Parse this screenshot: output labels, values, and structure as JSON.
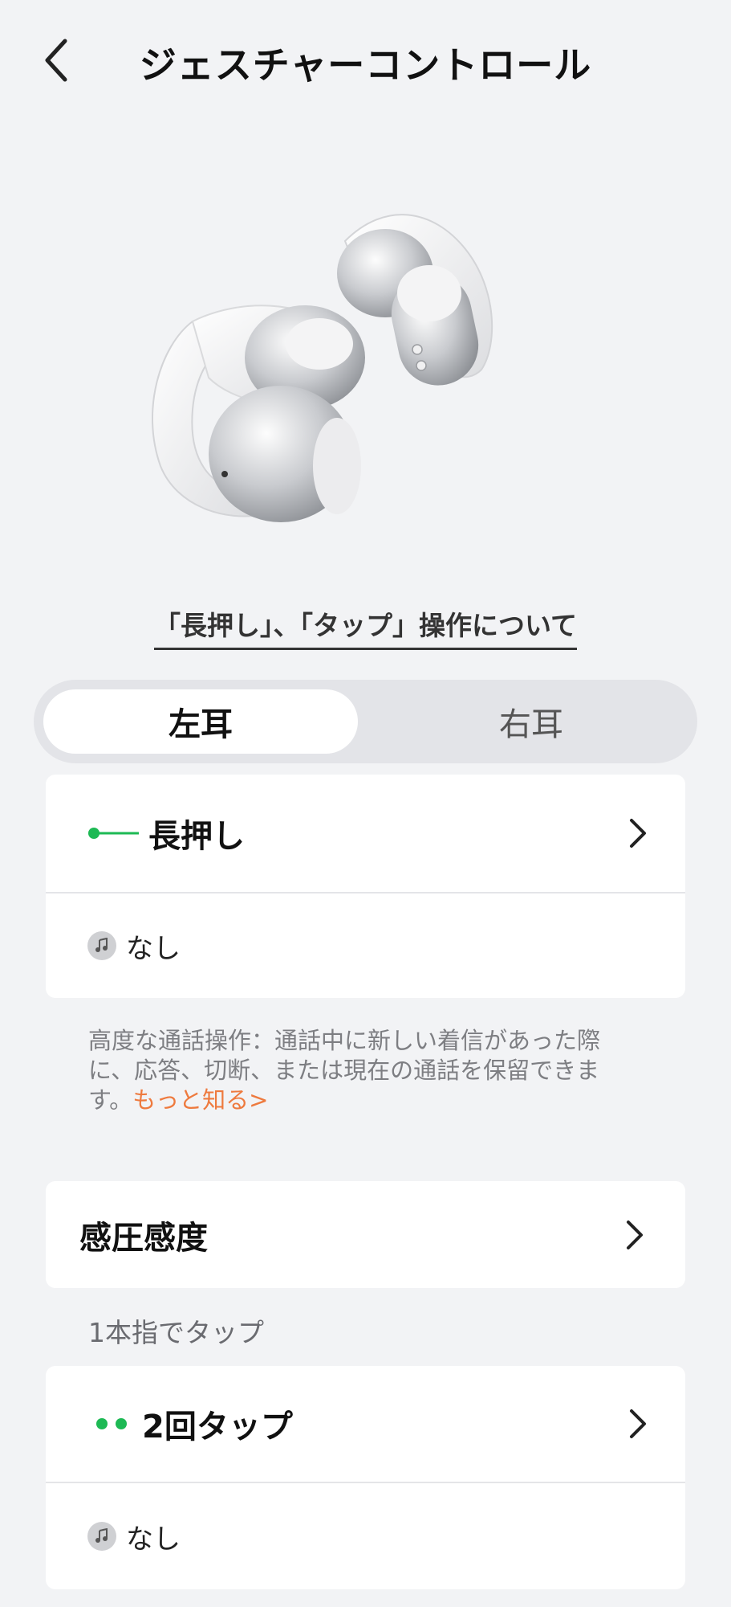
{
  "header": {
    "title": "ジェスチャーコントロール"
  },
  "gesture_info_link": "「長押し」、「タップ」操作について",
  "ear_tabs": {
    "left": "左耳",
    "right": "右耳",
    "selected": "左耳"
  },
  "long_press": {
    "title": "長押し",
    "action": "なし"
  },
  "call_note": {
    "text": "高度な通話操作：通話中に新しい着信があった際に、応答、切断、または現在の通話を保留できます。",
    "link": "もっと知る>"
  },
  "pressure_sensitivity": {
    "title": "感圧感度"
  },
  "one_finger_section": {
    "label": "1本指でタップ",
    "double_tap": {
      "title": "2回タップ",
      "action": "なし"
    }
  },
  "colors": {
    "accent_green": "#1db954",
    "link_orange": "#ee7a3e",
    "background": "#f2f3f5"
  },
  "icons": [
    "back-chevron-icon",
    "long-press-icon",
    "double-dot-icon",
    "music-note-icon",
    "chevron-right-icon"
  ]
}
